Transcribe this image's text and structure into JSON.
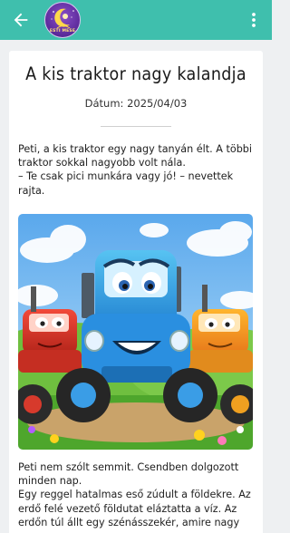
{
  "app_bar": {
    "logo_text": "ESTI MESE",
    "icons": {
      "back": "arrow-left-icon",
      "menu": "more-vertical-icon"
    },
    "color": "#3fbfad"
  },
  "story": {
    "title": "A kis traktor nagy kalandja",
    "date": "Dátum: 2025/04/03",
    "paragraph_1_lines": [
      "Peti, a kis traktor egy nagy tanyán élt. A többi",
      "traktor sokkal nagyobb volt nála.",
      "– Te csak pici munkára vagy jó! – nevettek",
      "rajta."
    ],
    "paragraph_2_lines": [
      "Peti nem szólt semmit. Csendben dolgozott",
      "minden nap.",
      "Egy reggel hatalmas eső zúdult a földekre. Az",
      "erdő felé vezető földutat eláztatta a víz. Az",
      "erdőn túl állt egy szénásszekér, amire nagy"
    ],
    "image": "illustration-three-cartoon-tractors"
  }
}
